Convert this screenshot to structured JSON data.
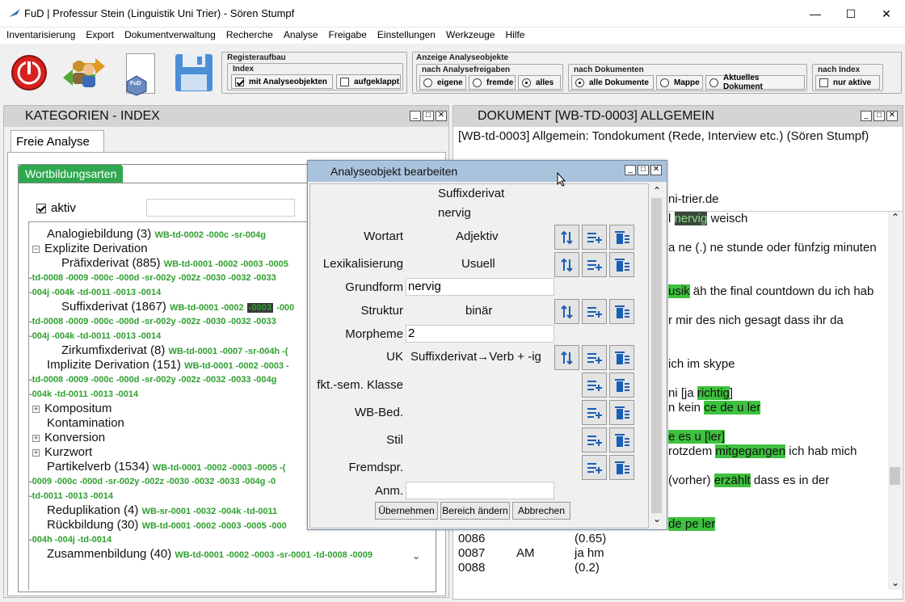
{
  "window": {
    "title": "FuD | Professur Stein (Linguistik Uni Trier) - Sören Stumpf",
    "minimize": "—",
    "maximize": "☐",
    "close": "✕"
  },
  "menu": [
    "Inventarisierung",
    "Export",
    "Dokumentverwaltung",
    "Recherche",
    "Analyse",
    "Freigabe",
    "Einstellungen",
    "Werkzeuge",
    "Hilfe"
  ],
  "toolbar": {
    "fud_label": "FuD",
    "register_title": "Registeraufbau",
    "index_title": "Index",
    "index_opt1": "mit Analyseobjekten",
    "index_opt2": "aufgeklappt",
    "anzeige_title": "Anzeige Analyseobjekte",
    "freigabe_title": "nach Analysefreigaben",
    "freigabe_opts": [
      "eigene",
      "fremde",
      "alles"
    ],
    "dokumente_title": "nach Dokumenten",
    "dokumente_opts": [
      "alle Dokumente",
      "Mappe",
      "Aktuelles Dokument"
    ],
    "index2_title": "nach Index",
    "index2_opt": "nur aktive"
  },
  "left_panel": {
    "title": "KATEGORIEN - INDEX",
    "tab": "Freie Analyse",
    "subtab": "Wortbildungsarten",
    "aktiv_label": "aktiv",
    "tree": {
      "analogie": "Analogiebildung (3)",
      "analogie_tags": "WB-td-0002  -000c  -sr-004g",
      "explizit": "Explizite Derivation",
      "praefix": "Präfixderivat (885)",
      "praefix_tags1": "WB-td-0001  -0002  -0003  -0005",
      "praefix_tags2": "-td-0008  -0009  -000c  -000d  -sr-002y  -002z  -0030  -0032  -0033",
      "praefix_tags3": "-004j  -004k  -td-0011  -0013  -0014",
      "suffix": "Suffixderivat (1867)",
      "suffix_tags1a": "WB-td-0001  -0002",
      "suffix_tags1b": "-0003",
      "suffix_tags1c": "-000",
      "suffix_tags2": "-td-0008  -0009  -000c  -000d  -sr-002y  -002z  -0030  -0032  -0033",
      "suffix_tags3": "-004j  -004k  -td-0011  -0013  -0014",
      "zirkum": "Zirkumfixderivat (8)",
      "zirkum_tags": "WB-td-0001  -0007  -sr-004h  -(",
      "implizit": "Implizite Derivation (151)",
      "implizit_tags1": "WB-td-0001  -0002  -0003  -",
      "implizit_tags2": "-td-0008  -0009  -000c  -000d  -sr-002y  -002z  -0032  -0033  -004g",
      "implizit_tags3": "-004k  -td-0011  -0013  -0014",
      "kompositum": "Kompositum",
      "kontamination": "Kontamination",
      "konversion": "Konversion",
      "kurzwort": "Kurzwort",
      "partikel": "Partikelverb (1534)",
      "partikel_tags1": "WB-td-0001  -0002  -0003  -0005  -(",
      "partikel_tags2": "-0009  -000c  -000d  -sr-002y  -002z  -0030  -0032  -0033  -004g  -0",
      "partikel_tags3": "-td-0011  -0013  -0014",
      "redup": "Reduplikation (4)",
      "redup_tags": "WB-sr-0001  -0032  -004k  -td-0011",
      "rueck": "Rückbildung (30)",
      "rueck_tags1": "WB-td-0001  -0002  -0003  -0005  -000",
      "rueck_tags2": "-004h  -004j  -td-0014",
      "zusammen": "Zusammenbildung (40)",
      "zusammen_tags": "WB-td-0001  -0002  -0003  -sr-0001  -td-0008  -0009"
    }
  },
  "right_panel": {
    "title": "DOKUMENT  [WB-TD-0003] ALLGEMEIN",
    "subtitle": "[WB-td-0003] Allgemein: Tondokument (Rede, Interview etc.) (Sören Stumpf)",
    "email_frag": "ni-trier.de",
    "lines": {
      "l1a": "l ",
      "l1b": "nervig",
      "l1c": " weisch",
      "l2": "a ne (.) ne stunde oder fünfzig minuten",
      "l3a": "usik",
      "l3b": " äh the final countdown du ich hab",
      "l4": "r mir des nich gesagt dass ihr da",
      "l5": "ich im skype",
      "l6a": "ni [ja ",
      "l6b": "richtig",
      "l6c": "]",
      "l7a": "n kein ",
      "l7b": "ce de u ler",
      "l8a": "e es u [ler]",
      "l9a": "rotzdem ",
      "l9b": "mitgegangen",
      "l9c": " ich hab mich",
      "l10a": "(vorher) ",
      "l10b": "erzählt",
      "l10c": " dass es in der",
      "l11": "de pe ler"
    },
    "rows": [
      {
        "num": "0086",
        "speaker": "",
        "text": "(0.65)"
      },
      {
        "num": "0087",
        "speaker": "AM",
        "text": "ja hm"
      },
      {
        "num": "0088",
        "speaker": "",
        "text": "(0.2)"
      }
    ]
  },
  "dialog": {
    "title": "Analyseobjekt bearbeiten",
    "kategorie": "Suffixderivat",
    "wort": "nervig",
    "fields": {
      "wortart_label": "Wortart",
      "wortart_value": "Adjektiv",
      "lex_label": "Lexikalisierung",
      "lex_value": "Usuell",
      "grundform_label": "Grundform",
      "grundform_value": "nervig",
      "struktur_label": "Struktur",
      "struktur_value": "binär",
      "morpheme_label": "Morpheme",
      "morpheme_value": "2",
      "uk_label": "UK",
      "uk_value": "Suffixderivat→Verb + -ig",
      "fkt_label": "fkt.-sem. Klasse",
      "wbbed_label": "WB-Bed.",
      "stil_label": "Stil",
      "fremd_label": "Fremdspr.",
      "anm_label": "Anm."
    },
    "buttons": {
      "ok": "Übernehmen",
      "range": "Bereich ändern",
      "cancel": "Abbrechen"
    }
  }
}
